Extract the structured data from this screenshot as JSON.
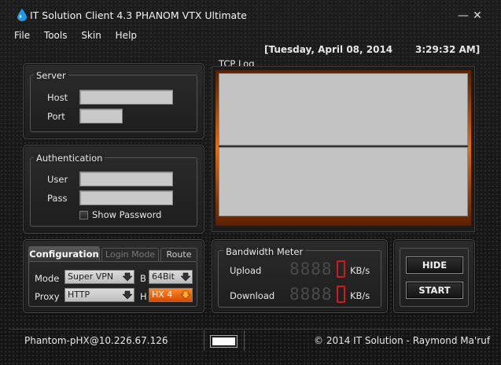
{
  "window": {
    "title": "IT Solution Client 4.3 PHANOM VTX Ultimate",
    "minimize_glyph": "—",
    "close_glyph": "✕"
  },
  "menu": [
    "File",
    "Tools",
    "Skin",
    "Help"
  ],
  "clock": {
    "date": "[Tuesday, April 08, 2014",
    "time": "3:29:32 AM]"
  },
  "server": {
    "legend": "Server",
    "host_label": "Host",
    "host_value": "",
    "port_label": "Port",
    "port_value": ""
  },
  "auth": {
    "legend": "Authentication",
    "user_label": "User",
    "user_value": "",
    "pass_label": "Pass",
    "pass_value": "",
    "show_password_label": "Show Password",
    "show_password_checked": false
  },
  "tcp_log": {
    "title": "TCP Log"
  },
  "config": {
    "tabs": [
      {
        "label": "Configuration",
        "active": true
      },
      {
        "label": "Login Mode",
        "active": false
      },
      {
        "label": "Route",
        "active": false
      }
    ],
    "mode_label": "Mode",
    "mode_value": "Super VPN",
    "b_label": "B",
    "b_value": "64Bit",
    "proxy_label": "Proxy",
    "proxy_value": "HTTP",
    "h_label": "H",
    "h_value": "HX 4"
  },
  "bandwidth": {
    "legend": "Bandwidth Meter",
    "upload_label": "Upload",
    "download_label": "Download",
    "unit": "KB/s",
    "upload_digits": "8888",
    "download_digits": "8888"
  },
  "actions": {
    "hide_label": "HIDE",
    "start_label": "START"
  },
  "status": {
    "user": "Phantom-pHX@10.226.67.126",
    "copyright": "© 2014 IT Solution - Raymond Ma'ruf"
  },
  "colors": {
    "accent_orange": "#f06a00",
    "meter_red": "#d21a1a",
    "window_bg": "#1a1a1a"
  }
}
